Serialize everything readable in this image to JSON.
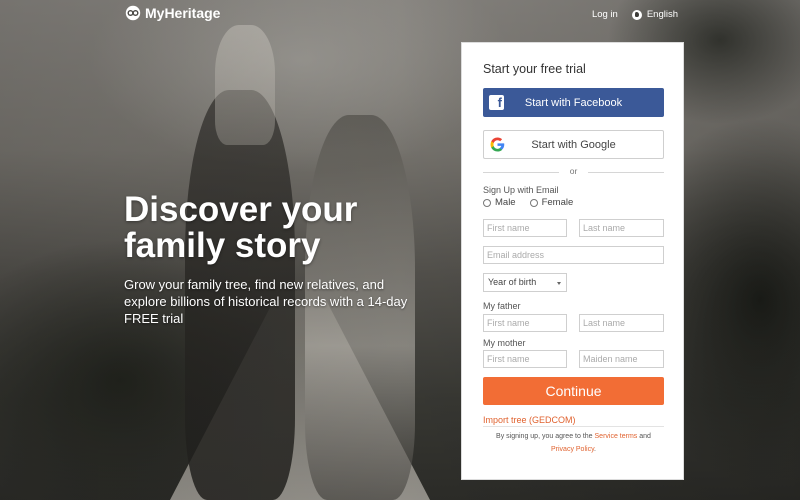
{
  "brand": {
    "name": "MyHeritage",
    "logo_icon": "myheritage-logo-icon"
  },
  "topnav": {
    "login": "Log in",
    "language": "English",
    "language_icon": "globe-icon"
  },
  "hero": {
    "title_line1": "Discover your",
    "title_line2": "family story",
    "subtitle": "Grow your family tree, find new relatives, and explore billions of historical records with a 14-day FREE trial"
  },
  "signup": {
    "title": "Start your free trial",
    "facebook_label": "Start with Facebook",
    "google_label": "Start with Google",
    "or": "or",
    "email_heading": "Sign Up with Email",
    "gender": {
      "male": "Male",
      "female": "Female"
    },
    "first_name_placeholder": "First name",
    "last_name_placeholder": "Last name",
    "email_placeholder": "Email address",
    "year_of_birth": "Year of birth",
    "father_heading": "My father",
    "father_first_placeholder": "First name",
    "father_last_placeholder": "Last name",
    "mother_heading": "My mother",
    "mother_first_placeholder": "First name",
    "mother_maiden_placeholder": "Maiden name",
    "continue_label": "Continue",
    "import_link": "Import tree (GEDCOM)",
    "terms_prefix": "By signing up, you agree to the",
    "terms_link": "Service terms",
    "terms_and": "and",
    "privacy_link": "Privacy Policy",
    "terms_suffix": "."
  },
  "colors": {
    "facebook": "#3b5998",
    "continue": "#f26d35",
    "link": "#e0622f"
  }
}
